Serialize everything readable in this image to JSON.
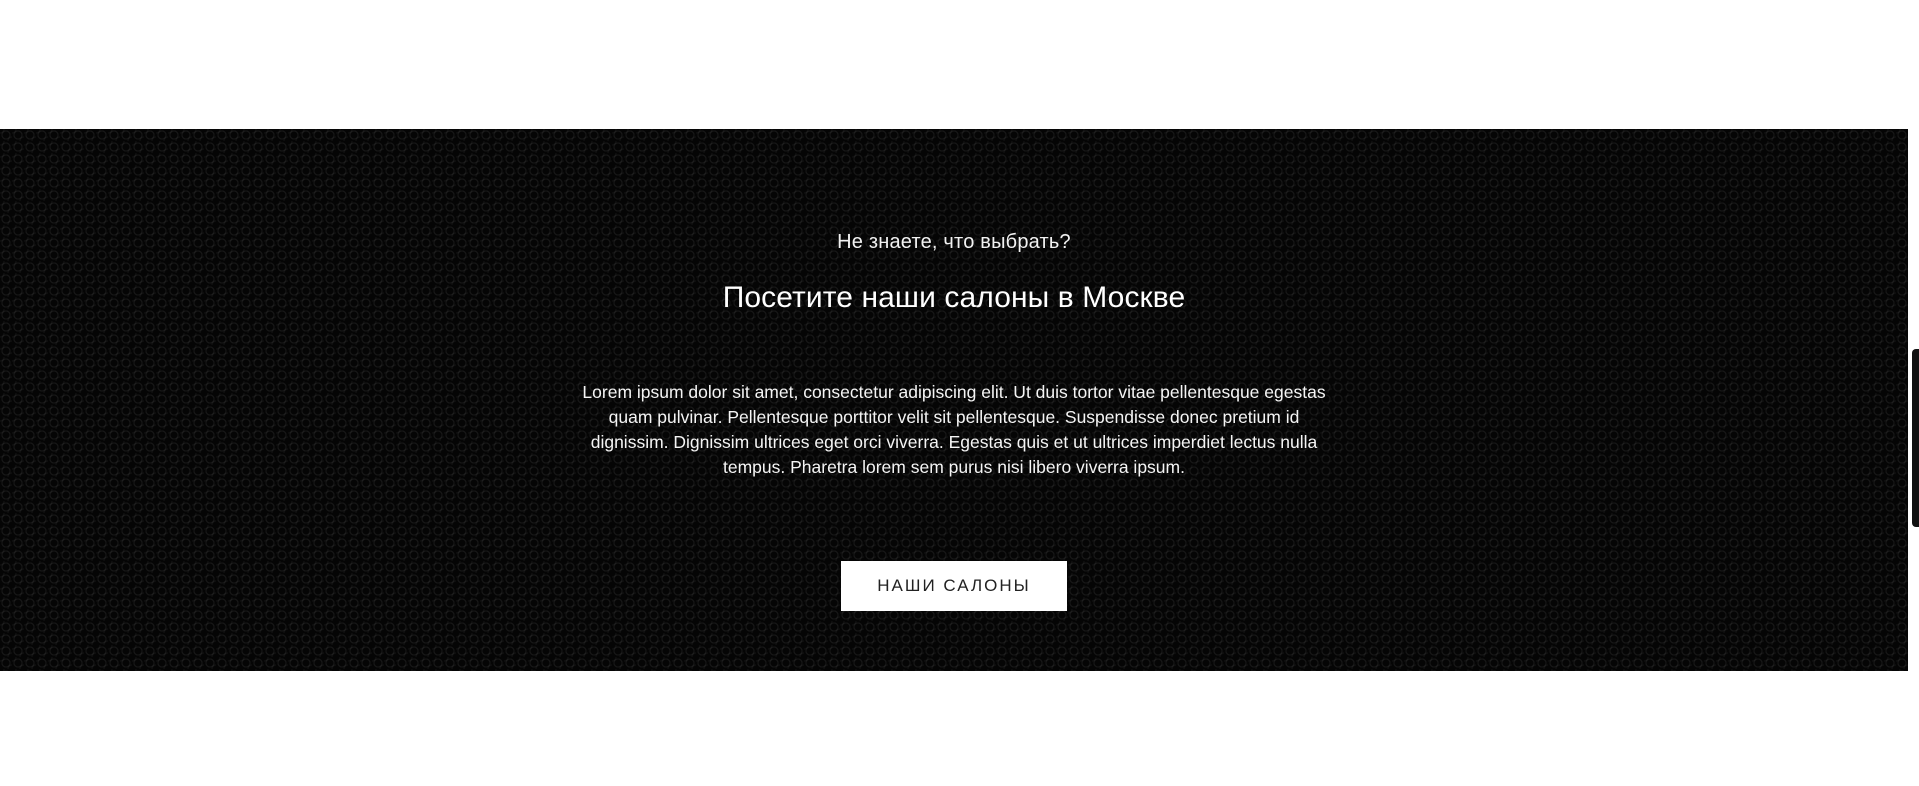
{
  "banner": {
    "subtitle": "Не знаете, что выбрать?",
    "title": "Посетите наши салоны в Москве",
    "description": "Lorem ipsum dolor sit amet, consectetur adipiscing elit. Ut duis tortor vitae pellentesque egestas quam pulvinar. Pellentesque porttitor velit sit pellentesque. Suspendisse donec pretium id dignissim. Dignissim ultrices eget orci viverra. Egestas quis et ut ultrices imperdiet lectus nulla tempus. Pharetra lorem sem purus nisi libero viverra ipsum.",
    "button_label": "НАШИ САЛОНЫ"
  },
  "colors": {
    "banner_background": "#050505",
    "button_background": "#ffffff",
    "text": "#ffffff"
  }
}
